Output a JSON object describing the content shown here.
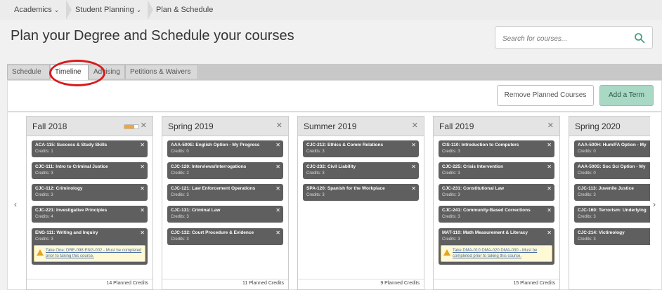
{
  "breadcrumb": {
    "items": [
      "Academics",
      "Student Planning",
      "Plan & Schedule"
    ]
  },
  "header": {
    "title": "Plan your Degree and Schedule your courses"
  },
  "search": {
    "placeholder": "Search for courses..."
  },
  "tabs": [
    "Schedule",
    "Timeline",
    "Advising",
    "Petitions & Waivers"
  ],
  "actions": {
    "remove_label": "Remove Planned Courses",
    "add_label": "Add a Term"
  },
  "terms": [
    {
      "name": "Fall 2018",
      "progress": 0.7,
      "courses": [
        {
          "name": "ACA-115: Success & Study Skills",
          "credits": "Credits: 1"
        },
        {
          "name": "CJC-111: Intro to Criminal Justice",
          "credits": "Credits: 3"
        },
        {
          "name": "CJC-112: Criminology",
          "credits": "Credits: 3"
        },
        {
          "name": "CJC-221: Investigative Principles",
          "credits": "Credits: 4"
        },
        {
          "name": "ENG-111: Writing and Inquiry",
          "credits": "Credits: 3",
          "warning": "Take One: DRE-098 ENG-002 - Must be completed prior to taking this course."
        }
      ],
      "planned": "14 Planned Credits"
    },
    {
      "name": "Spring 2019",
      "courses": [
        {
          "name": "AAA-500E: English Option - My Progress",
          "credits": "Credits: 0"
        },
        {
          "name": "CJC-120: Interviews/Interrogations",
          "credits": "Credits: 2"
        },
        {
          "name": "CJC-121: Law Enforcement Operations",
          "credits": "Credits: 3"
        },
        {
          "name": "CJC-131: Criminal Law",
          "credits": "Credits: 3"
        },
        {
          "name": "CJC-132: Court Procedure & Evidence",
          "credits": "Credits: 3"
        }
      ],
      "planned": "11 Planned Credits"
    },
    {
      "name": "Summer 2019",
      "courses": [
        {
          "name": "CJC-212: Ethics & Comm Relations",
          "credits": "Credits: 3"
        },
        {
          "name": "CJC-232: Civil Liability",
          "credits": "Credits: 3"
        },
        {
          "name": "SPA-120: Spanish for the Workplace",
          "credits": "Credits: 3"
        }
      ],
      "planned": "9 Planned Credits"
    },
    {
      "name": "Fall 2019",
      "courses": [
        {
          "name": "CIS-110: Introduction to Computers",
          "credits": "Credits: 3"
        },
        {
          "name": "CJC-225: Crisis Intervention",
          "credits": "Credits: 3"
        },
        {
          "name": "CJC-231: Constitutional Law",
          "credits": "Credits: 3"
        },
        {
          "name": "CJC-241: Community-Based Corrections",
          "credits": "Credits: 3"
        },
        {
          "name": "MAT-110: Math Measurement & Literacy",
          "credits": "Credits: 3",
          "warning": "Take DMA-010 DMA-020 DMA-030 - Must be completed prior to taking this course."
        }
      ],
      "planned": "15 Planned Credits"
    },
    {
      "name": "Spring 2020",
      "courses": [
        {
          "name": "AAA-500H: Hum/FA Option - My",
          "credits": "Credits: 0"
        },
        {
          "name": "AAA-500S: Soc Sci Option - My",
          "credits": "Credits: 0"
        },
        {
          "name": "CJC-113: Juvenile Justice",
          "credits": "Credits: 3"
        },
        {
          "name": "CJC-160: Terrorism: Underlying",
          "credits": "Credits: 3"
        },
        {
          "name": "CJC-214: Victimology",
          "credits": "Credits: 3"
        }
      ],
      "planned": ""
    }
  ],
  "icons": {
    "close": "close-icon",
    "search": "search-icon",
    "warning": "warning-icon",
    "prev": "chevron-left-icon",
    "next": "chevron-right-icon"
  },
  "colors": {
    "accent_green": "#a9d8c5",
    "course_bg": "#5f5f5f",
    "warning_bg": "#fff9d6",
    "highlight": "#d9191c"
  }
}
